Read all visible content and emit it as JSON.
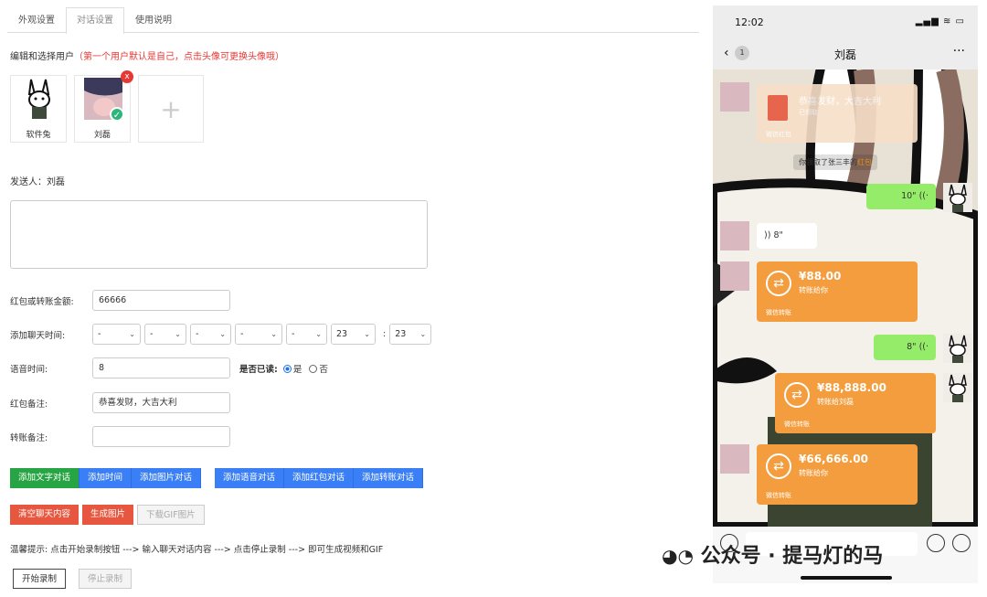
{
  "tabs": [
    "外观设置",
    "对话设置",
    "使用说明"
  ],
  "hint": {
    "prefix": "编辑和选择用户",
    "red": "（第一个用户默认是自己，点击头像可更换头像哦）"
  },
  "users": [
    {
      "name": "软件兔"
    },
    {
      "name": "刘磊"
    }
  ],
  "add_user_symbol": "+",
  "del_symbol": "x",
  "check_symbol": "✓",
  "sender": "发送人：刘磊",
  "fields": {
    "amount_label": "红包或转账金额:",
    "amount_value": "66666",
    "time_label": "添加聊天时间:",
    "time_selects": [
      "-",
      "-",
      "-",
      "-",
      "-",
      "23",
      "23"
    ],
    "time_sep": ":",
    "voice_label": "语音时间:",
    "voice_value": "8",
    "read_label": "是否已读:",
    "read_yes": "是",
    "read_no": "否",
    "redpacket_label": "红包备注:",
    "redpacket_value": "恭喜发财，大吉大利",
    "transfer_label": "转账备注:",
    "transfer_value": ""
  },
  "buttons": {
    "add_text": "添加文字对话",
    "add_time": "添加时间",
    "add_image": "添加图片对话",
    "add_voice": "添加语音对话",
    "add_redpacket": "添加红包对话",
    "add_transfer": "添加转账对话",
    "clear": "清空聊天内容",
    "gen_image": "生成图片",
    "download_gif": "下载GIF图片",
    "start_record": "开始录制",
    "stop_record": "停止录制"
  },
  "tip": "温馨提示: 点击开始录制按钮 ---> 输入聊天对话内容 ---> 点击停止录制 ---> 即可生成视频和GIF",
  "phone": {
    "time": "12:02",
    "signal": "▂▄▆ ≋ ▭",
    "back": "‹",
    "badge": "1",
    "title": "刘磊",
    "more": "···",
    "redpacket_text": "恭喜发财，大吉大利",
    "redpacket_sub": "已领取",
    "redpacket_foot": "微信红包",
    "sysmsg_pre": "你领取了张三丰的",
    "sysmsg_hl": "红包",
    "voice1": "10\"",
    "voice2": "8\"",
    "voice3": "8\"",
    "voice_icon": "((·",
    "transfers": [
      {
        "amount": "¥88.00",
        "sub": "转账给你",
        "foot": "微信转账"
      },
      {
        "amount": "¥88,888.00",
        "sub": "转账给刘磊",
        "foot": "微信转账"
      },
      {
        "amount": "¥66,666.00",
        "sub": "转账给你",
        "foot": "微信转账"
      }
    ],
    "transfer_symbol": "⇄"
  },
  "watermark": "公众号 · 提马灯的马"
}
